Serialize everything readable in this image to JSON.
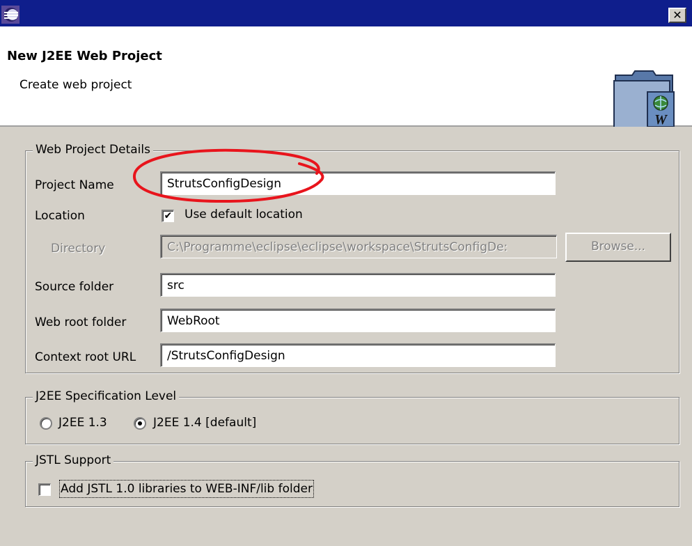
{
  "window": {
    "close_glyph": "✕",
    "app_icon": "eclipse-icon"
  },
  "banner": {
    "title": "New J2EE Web Project",
    "description": "Create web project",
    "icon": "web-project-wizard-icon",
    "icon_letter": "W"
  },
  "web_project_details": {
    "group_label": "Web Project Details",
    "project_name_label": "Project Name",
    "project_name_value": "StrutsConfigDesign",
    "location_label": "Location",
    "use_default_location_label": "Use default location",
    "use_default_location_checked": true,
    "directory_label": "Directory",
    "directory_value": "C:\\Programme\\eclipse\\eclipse\\workspace\\StrutsConfigDe:",
    "browse_label": "Browse...",
    "source_folder_label": "Source folder",
    "source_folder_value": "src",
    "web_root_folder_label": "Web root folder",
    "web_root_folder_value": "WebRoot",
    "context_root_url_label": "Context root URL",
    "context_root_url_value": "/StrutsConfigDesign"
  },
  "j2ee_spec": {
    "group_label": "J2EE Specification Level",
    "options": [
      {
        "label": "J2EE 1.3",
        "selected": false
      },
      {
        "label": "J2EE 1.4 [default]",
        "selected": true
      }
    ]
  },
  "jstl": {
    "group_label": "JSTL Support",
    "add_jstl_label": "Add JSTL 1.0 libraries to WEB-INF/lib folder",
    "add_jstl_checked": false
  },
  "colors": {
    "titlebar": "#0f1e8c",
    "dialog_bg": "#d4d0c8",
    "annotation": "#e8141c"
  }
}
